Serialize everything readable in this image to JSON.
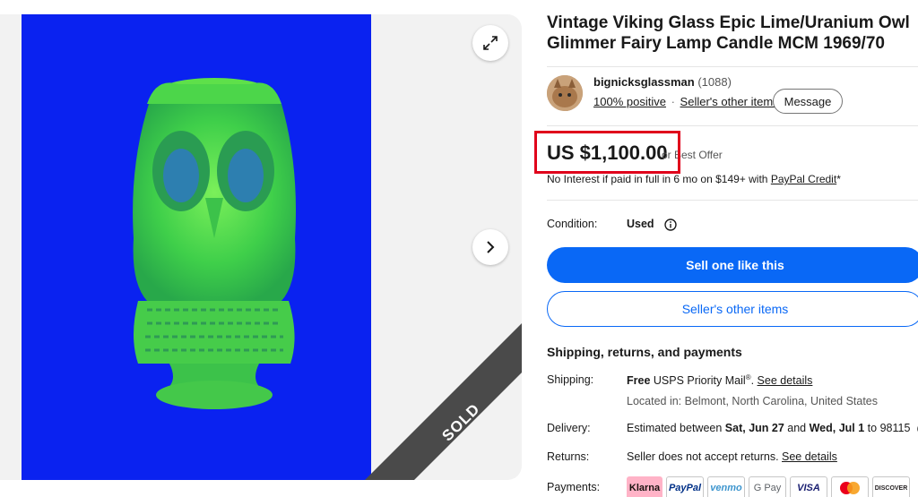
{
  "listing": {
    "title": "Vintage Viking Glass Epic Lime/Uranium Owl Glimmer Fairy Lamp Candle MCM 1969/70",
    "sold_badge": "SOLD"
  },
  "seller": {
    "name": "bignicksglassman",
    "feedback_count": "(1088)",
    "positive": "100% positive",
    "separator": "·",
    "other_items_link": "Seller's other items",
    "message_button": "Message"
  },
  "price": {
    "amount": "US $1,100.00",
    "best_offer": "or Best Offer",
    "financing_text": "No Interest if paid in full in 6 mo on $149+ with ",
    "financing_link": "PayPal Credit",
    "financing_suffix": "*"
  },
  "condition": {
    "label": "Condition:",
    "value": "Used"
  },
  "actions": {
    "primary": "Sell one like this",
    "secondary": "Seller's other items"
  },
  "shipping": {
    "heading": "Shipping, returns, and payments",
    "shipping_label": "Shipping:",
    "shipping_free": "Free",
    "shipping_service": " USPS Priority Mail",
    "shipping_reg": "®",
    "shipping_link": "See details",
    "location": "Located in: Belmont, North Carolina, United States",
    "delivery_label": "Delivery:",
    "delivery_prefix": "Estimated between ",
    "delivery_start": "Sat, Jun 27",
    "delivery_and": " and ",
    "delivery_end": "Wed, Jul 1",
    "delivery_suffix": " to 98115",
    "returns_label": "Returns:",
    "returns_text": "Seller does not accept returns. ",
    "returns_link": "See details",
    "payments_label": "Payments:"
  },
  "payments": [
    "Klarna",
    "PayPal",
    "venmo",
    "G Pay",
    "VISA",
    "",
    "DISCOVER"
  ],
  "icons": [
    "expand-icon",
    "chevron-right-icon",
    "info-icon"
  ],
  "colors": {
    "accent": "#0968f6",
    "photo_bg": "#0a22f0",
    "glass": "#5ee04a",
    "highlight": "#e0001b"
  }
}
